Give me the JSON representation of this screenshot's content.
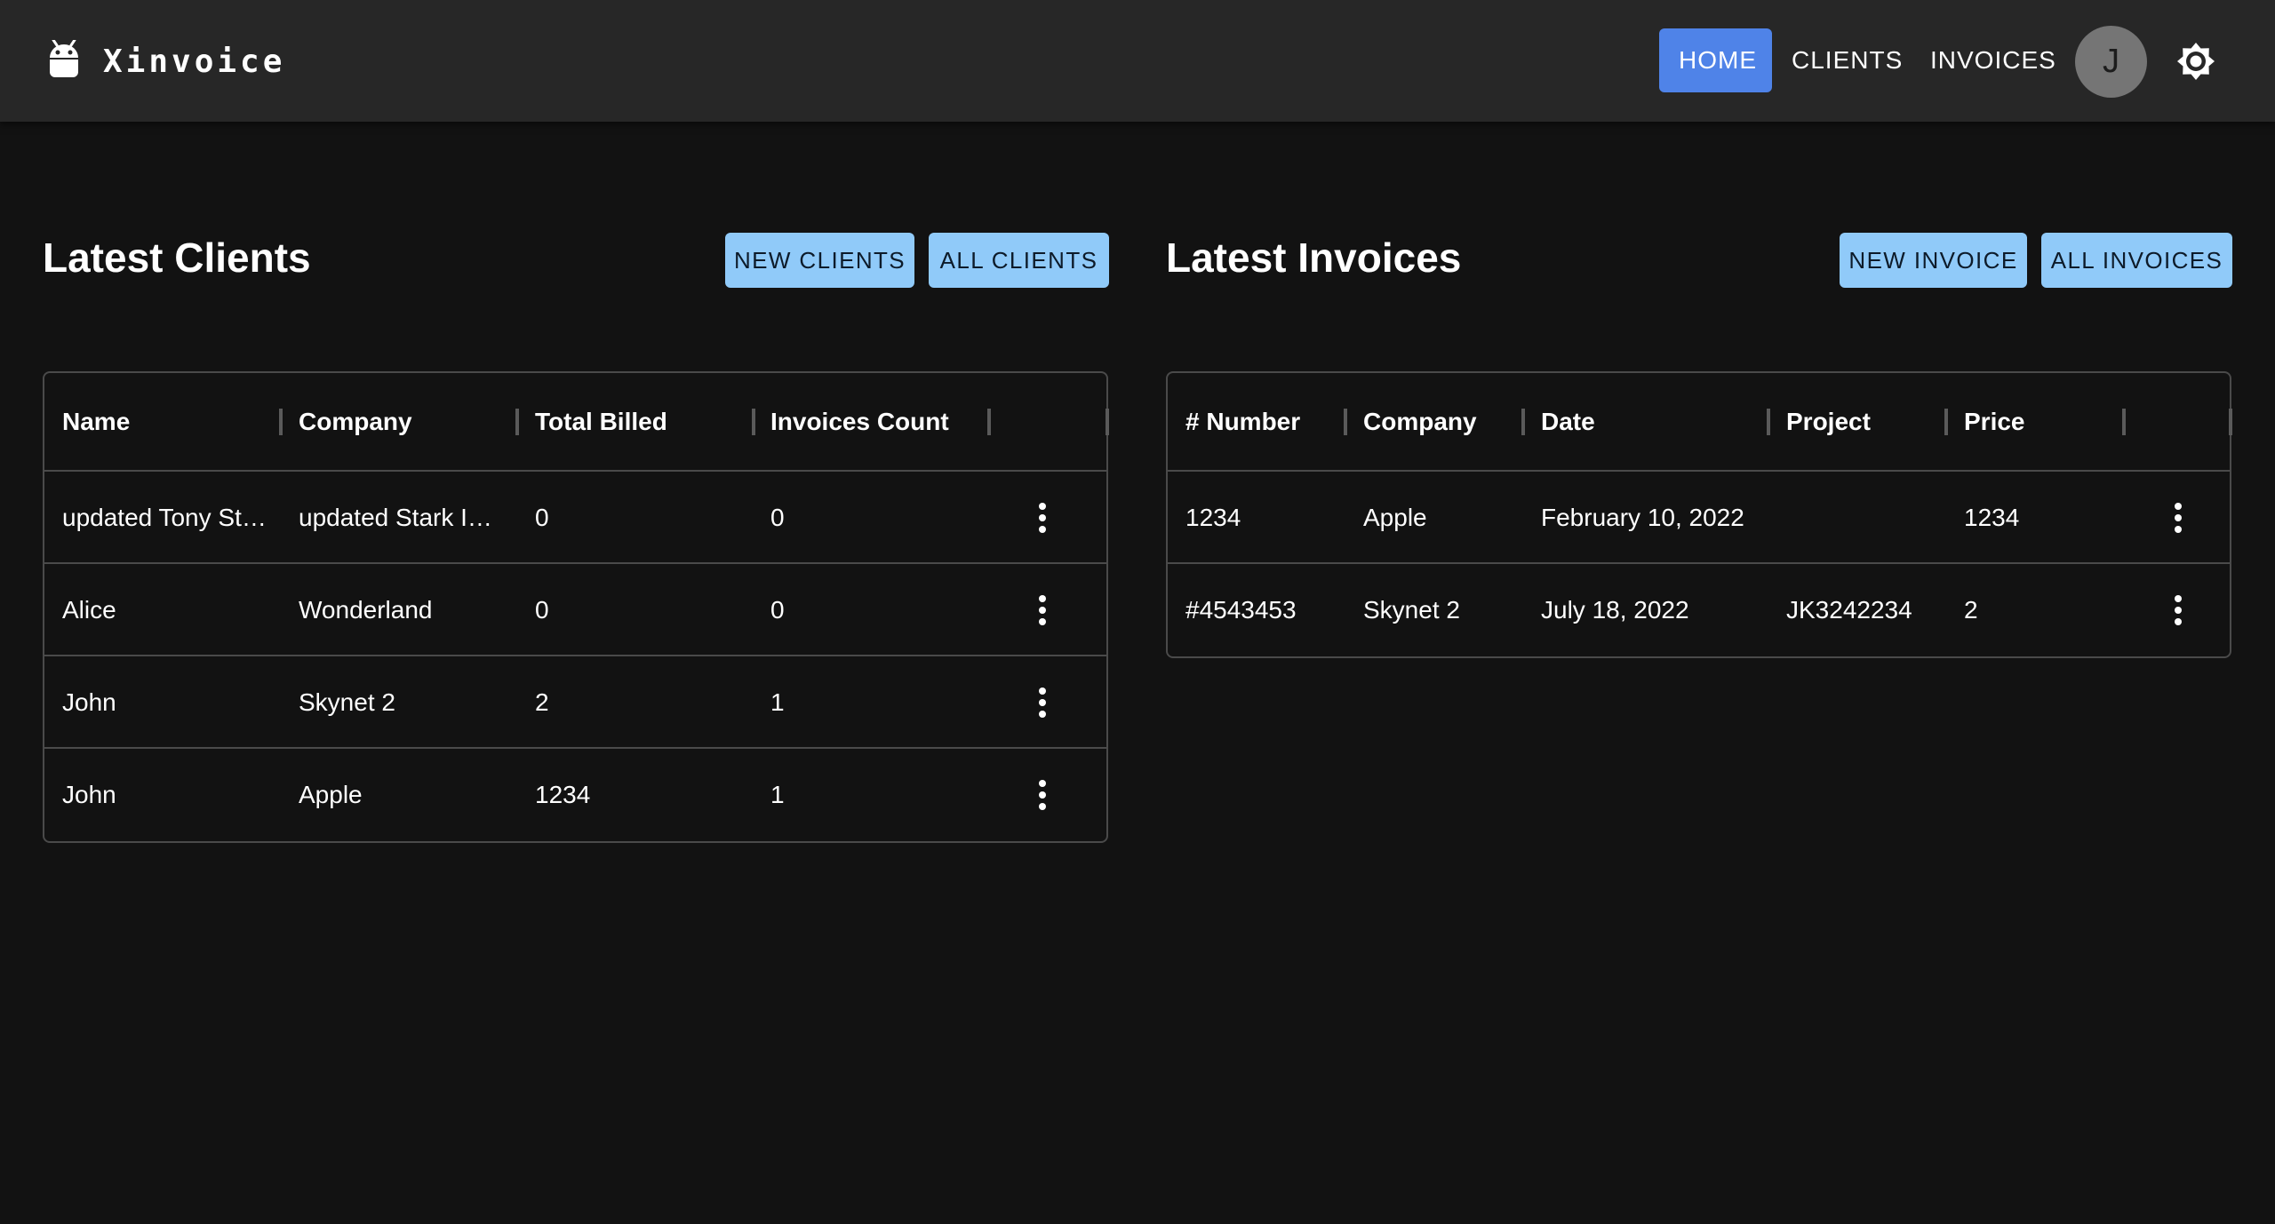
{
  "app": {
    "name": "Xinvoice"
  },
  "nav": {
    "items": [
      {
        "label": "HOME",
        "active": true
      },
      {
        "label": "CLIENTS",
        "active": false
      },
      {
        "label": "INVOICES",
        "active": false
      }
    ],
    "avatar_initial": "J",
    "theme_icon": "brightness-icon"
  },
  "colors": {
    "app_bar": "#272727",
    "background": "#121212",
    "active_nav": "#4f83e8",
    "action_button": "#90caf9"
  },
  "clients": {
    "title": "Latest Clients",
    "new_button": "NEW CLIENTS",
    "all_button": "ALL CLIENTS",
    "columns": [
      "Name",
      "Company",
      "Total Billed",
      "Invoices Count"
    ],
    "rows": [
      {
        "name": "updated Tony St…",
        "company": "updated Stark I…",
        "total_billed": "0",
        "invoices_count": "0"
      },
      {
        "name": "Alice",
        "company": "Wonderland",
        "total_billed": "0",
        "invoices_count": "0"
      },
      {
        "name": "John",
        "company": "Skynet 2",
        "total_billed": "2",
        "invoices_count": "1"
      },
      {
        "name": "John",
        "company": "Apple",
        "total_billed": "1234",
        "invoices_count": "1"
      }
    ]
  },
  "invoices": {
    "title": "Latest Invoices",
    "new_button": "NEW INVOICE",
    "all_button": "ALL INVOICES",
    "columns": [
      "# Number",
      "Company",
      "Date",
      "Project",
      "Price"
    ],
    "rows": [
      {
        "number": "1234",
        "company": "Apple",
        "date": "February 10, 2022",
        "project": "",
        "price": "1234"
      },
      {
        "number": "#4543453",
        "company": "Skynet 2",
        "date": "July 18, 2022",
        "project": "JK3242234",
        "price": "2"
      }
    ]
  }
}
